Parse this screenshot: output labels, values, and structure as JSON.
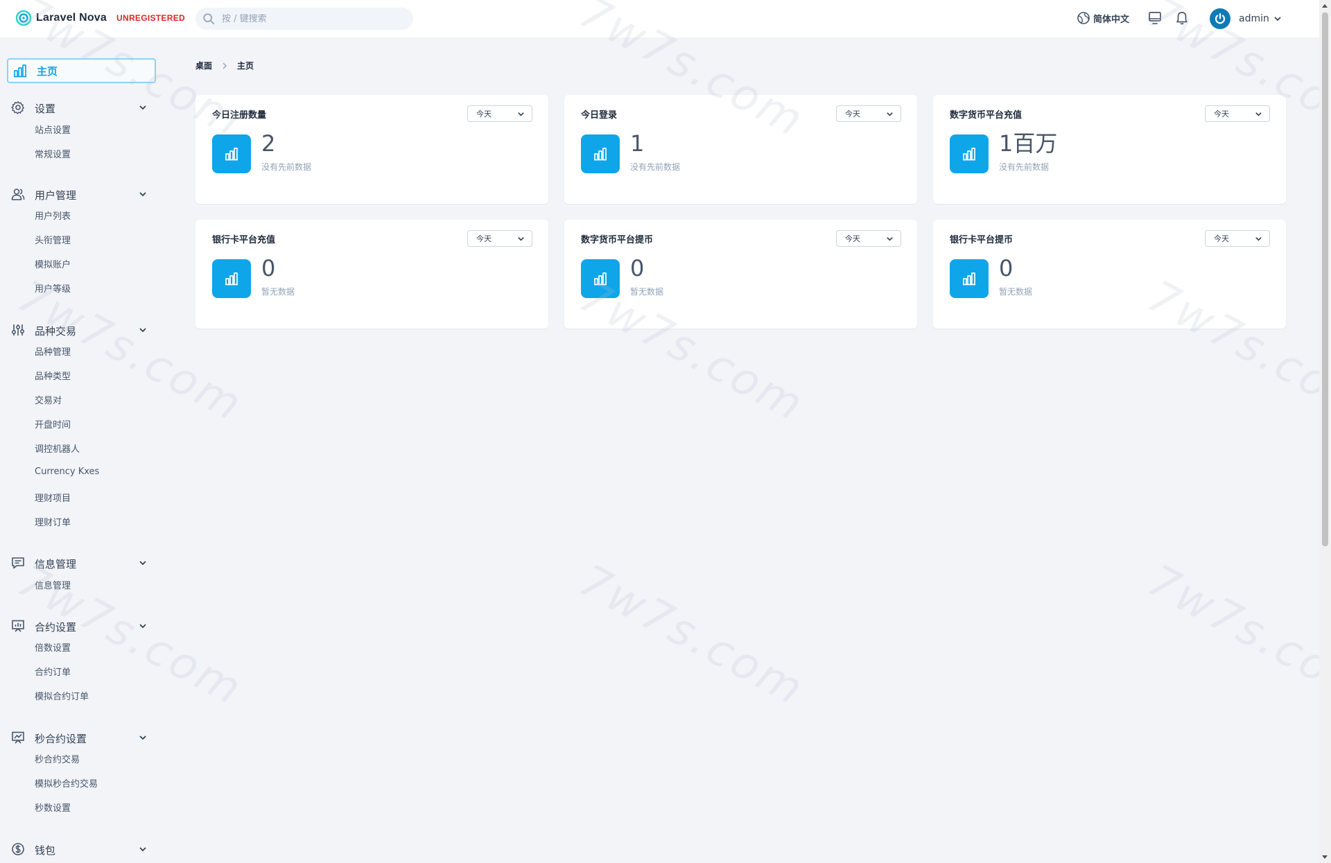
{
  "header": {
    "brand": "Laravel Nova",
    "badge": "UNREGISTERED",
    "search_placeholder": "按 / 键搜索",
    "language": "简体中文",
    "username": "admin"
  },
  "sidebar": {
    "home": "主页",
    "groups": [
      {
        "label": "设置",
        "icon": "gear-icon",
        "items": [
          "站点设置",
          "常规设置"
        ]
      },
      {
        "label": "用户管理",
        "icon": "users-icon",
        "items": [
          "用户列表",
          "头衔管理",
          "模拟账户",
          "用户等级"
        ]
      },
      {
        "label": "品种交易",
        "icon": "sliders-icon",
        "items": [
          "品种管理",
          "品种类型",
          "交易对",
          "开盘时间",
          "调控机器人",
          "Currency Kxes",
          "理财项目",
          "理财订单"
        ]
      },
      {
        "label": "信息管理",
        "icon": "message-icon",
        "items": [
          "信息管理"
        ]
      },
      {
        "label": "合约设置",
        "icon": "presentation-icon",
        "items": [
          "倍数设置",
          "合约订单",
          "模拟合约订单"
        ]
      },
      {
        "label": "秒合约设置",
        "icon": "chart-board-icon",
        "items": [
          "秒合约交易",
          "模拟秒合约交易",
          "秒数设置"
        ]
      },
      {
        "label": "钱包",
        "icon": "dollar-icon",
        "items": []
      }
    ]
  },
  "breadcrumb": {
    "root": "桌面",
    "current": "主页"
  },
  "cards": [
    {
      "title": "今日注册数量",
      "select": "今天",
      "value": "2",
      "note": "没有先前数据"
    },
    {
      "title": "今日登录",
      "select": "今天",
      "value": "1",
      "note": "没有先前数据"
    },
    {
      "title": "数字货币平台充值",
      "select": "今天",
      "value": "1百万",
      "note": "没有先前数据"
    },
    {
      "title": "银行卡平台充值",
      "select": "今天",
      "value": "0",
      "note": "暂无数据"
    },
    {
      "title": "数字货币平台提币",
      "select": "今天",
      "value": "0",
      "note": "暂无数据"
    },
    {
      "title": "银行卡平台提币",
      "select": "今天",
      "value": "0",
      "note": "暂无数据"
    }
  ],
  "watermark": "7w7s.com",
  "colors": {
    "accent": "#0ea5e9",
    "badge": "#dc2626",
    "background": "#f2f4f8"
  }
}
